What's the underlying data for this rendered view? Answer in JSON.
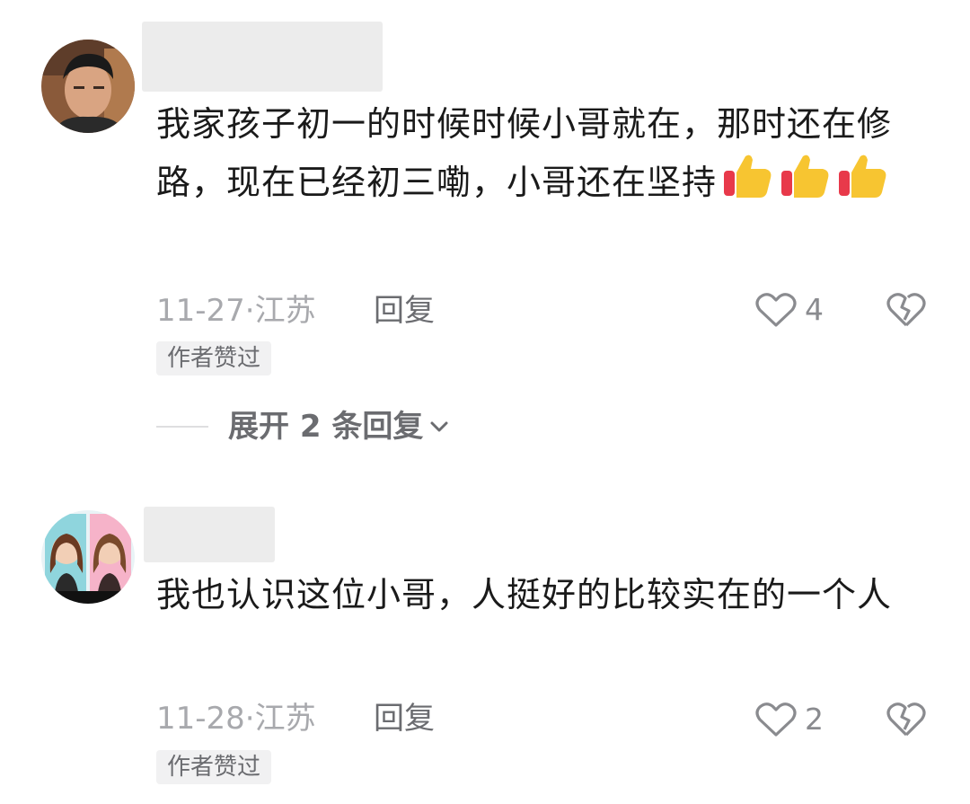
{
  "comments": [
    {
      "avatar": "man-portrait-avatar",
      "content": "我家孩子初一的时候时候小哥就在，那时还在修路，现在已经初三嘞，小哥还在坚持",
      "emoji_icon": "thumbs-up-icon",
      "date": "11-27",
      "location": "江苏",
      "reply_label": "回复",
      "like_count": "4",
      "badge": "作者赞过"
    },
    {
      "avatar": "cartoon-girls-avatar",
      "content": "我也认识这位小哥，人挺好的比较实在的一个人",
      "date": "11-28",
      "location": "江苏",
      "reply_label": "回复",
      "like_count": "2",
      "badge": "作者赞过"
    }
  ],
  "expand_replies": {
    "label": "展开 2 条回复"
  },
  "meta_separator": "·",
  "colors": {
    "meta_text": "#a8a9ad",
    "badge_bg": "#f1f1f2",
    "icon_stroke": "#8a8b8f"
  }
}
